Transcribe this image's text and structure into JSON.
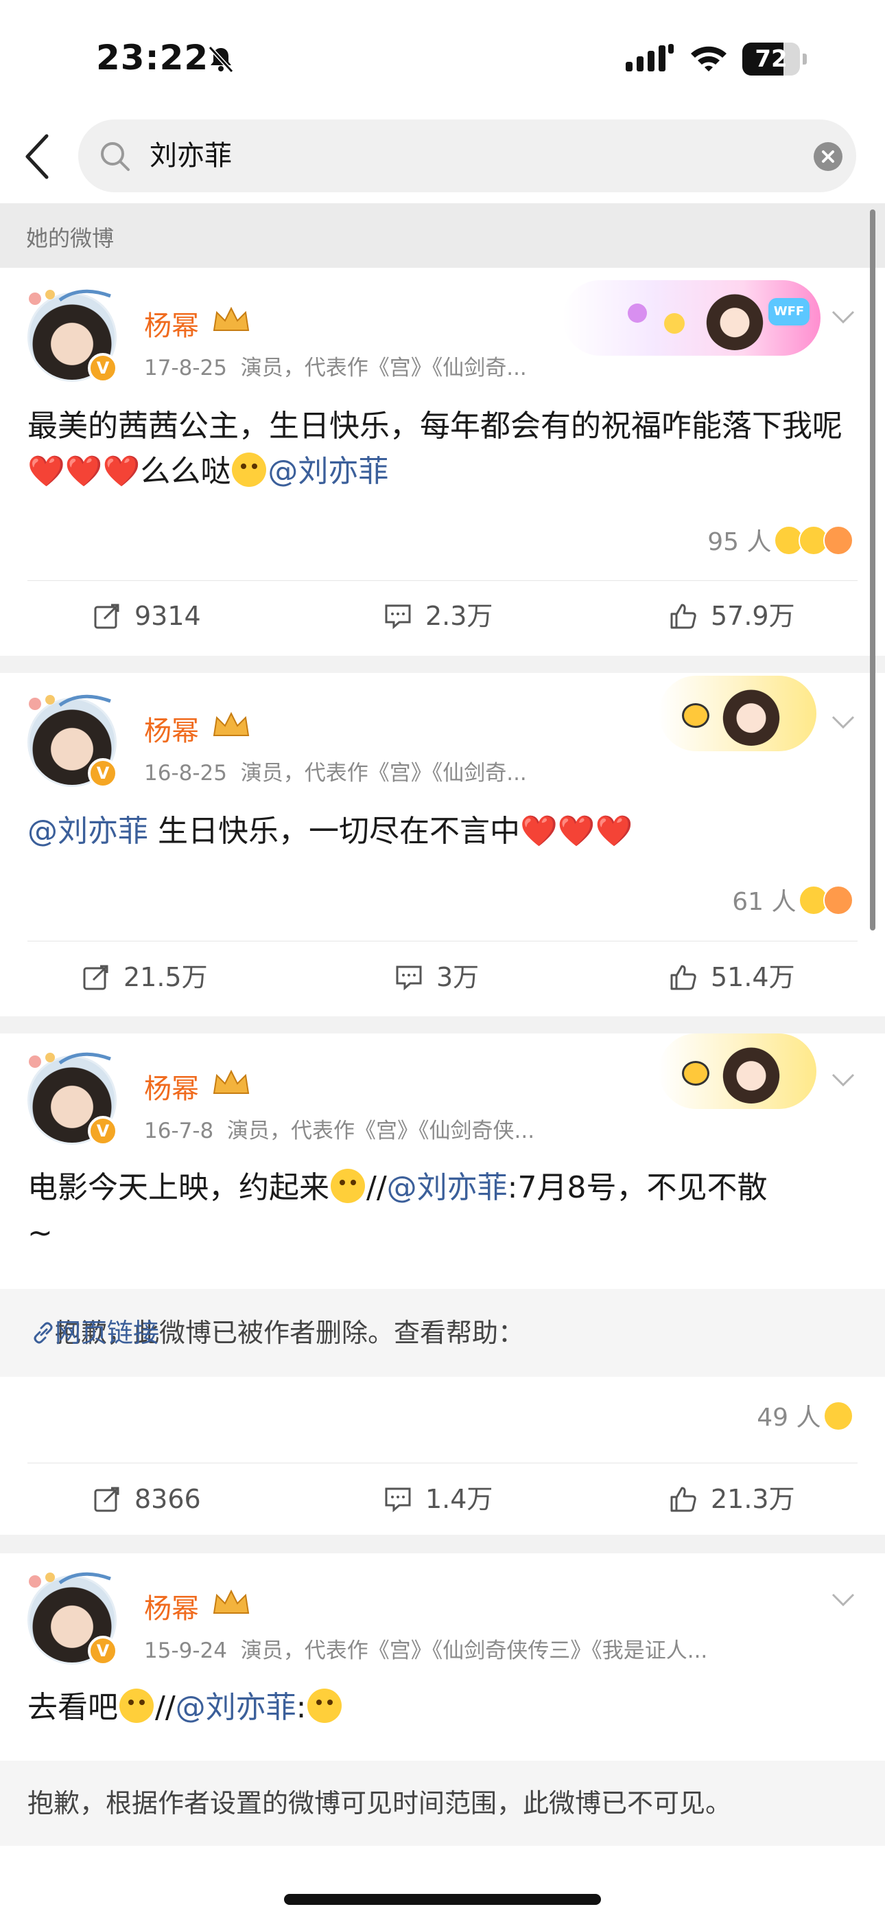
{
  "status_bar": {
    "time": "23:22",
    "battery": "72",
    "battery_level": 0.72
  },
  "search": {
    "query": "刘亦菲"
  },
  "section_label": "她的微博",
  "posts": [
    {
      "author": "杨幂",
      "date": "17-8-25",
      "meta": "演员，代表作《宫》《仙剑奇...",
      "text_before": "最美的茜茜公主，生日快乐，每年都会有的祝福咋能落下我呢",
      "hearts": "❤️❤️❤️",
      "text_mid": "么么哒",
      "mention": "@刘亦菲",
      "likers": "95 人",
      "reposts": "9314",
      "comments": "2.3万",
      "likes": "57.9万"
    },
    {
      "author": "杨幂",
      "date": "16-8-25",
      "meta": "演员，代表作《宫》《仙剑奇...",
      "mention": "@刘亦菲",
      "text": " 生日快乐，一切尽在不言中",
      "hearts": "❤️❤️❤️",
      "likers": "61 人",
      "reposts": "21.5万",
      "comments": "3万",
      "likes": "51.4万"
    },
    {
      "author": "杨幂",
      "date": "16-7-8",
      "meta": "演员，代表作《宫》《仙剑奇侠...",
      "text_before": "电影今天上映，约起来",
      "separator": "//",
      "mention": "@刘亦菲",
      "text_after": ":7月8号，不见不散",
      "text_tail": "~",
      "deleted_text": "抱歉，此微博已被作者删除。查看帮助：",
      "deleted_link": "网页链接",
      "likers": "49 人",
      "reposts": "8366",
      "comments": "1.4万",
      "likes": "21.3万"
    },
    {
      "author": "杨幂",
      "date": "15-9-24",
      "meta": "演员，代表作《宫》《仙剑奇侠传三》《我是证人...",
      "text_before": "去看吧",
      "separator": "//",
      "mention": "@刘亦菲",
      "colon": ":",
      "deleted_text": "抱歉，根据作者设置的微博可见时间范围，此微博已不可见。"
    }
  ]
}
